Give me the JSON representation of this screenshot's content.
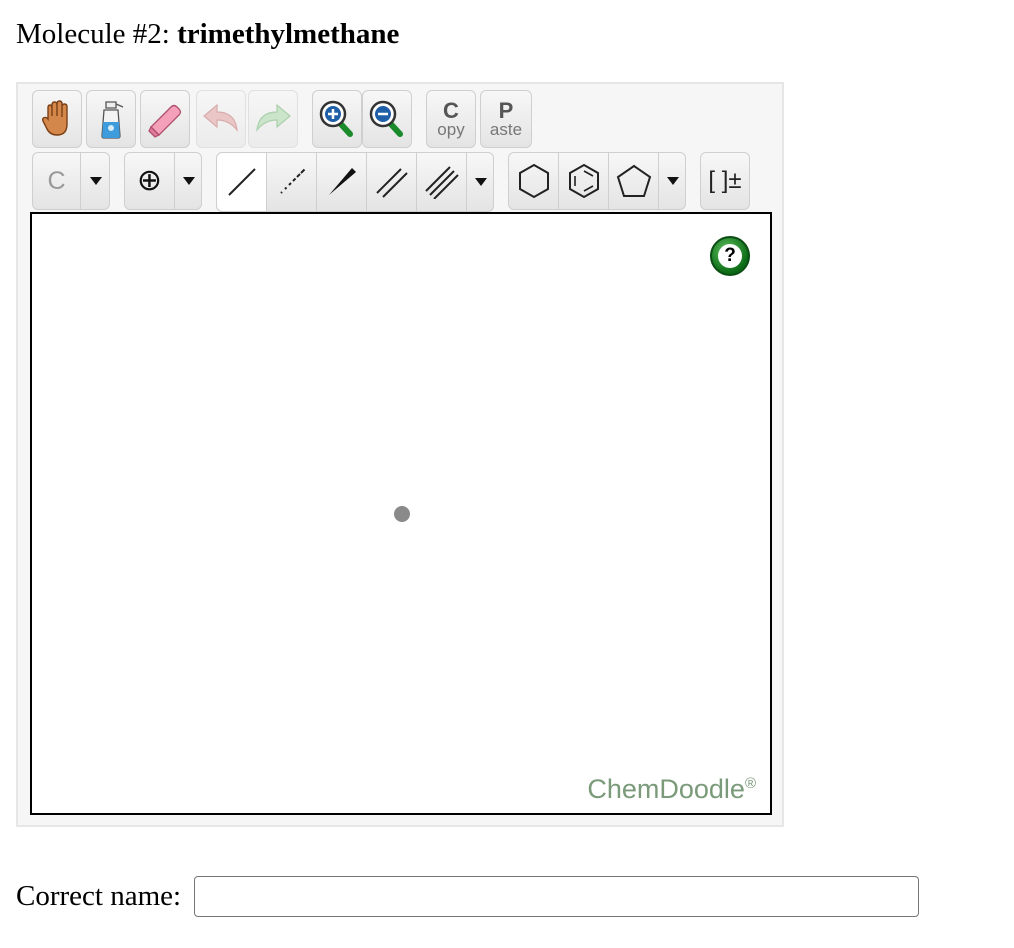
{
  "heading": {
    "prefix": "Molecule #2: ",
    "molecule": "trimethylmethane"
  },
  "toolbar": {
    "row1": [
      {
        "name": "pan-button",
        "icon": "hand-icon"
      },
      {
        "name": "clear-button",
        "icon": "spray-bottle-icon"
      },
      {
        "name": "erase-button",
        "icon": "eraser-icon"
      },
      {
        "name": "undo-button",
        "icon": "undo-icon"
      },
      {
        "name": "redo-button",
        "icon": "redo-icon"
      },
      {
        "name": "zoom-in-button",
        "icon": "zoom-in-icon"
      },
      {
        "name": "zoom-out-button",
        "icon": "zoom-out-icon"
      },
      {
        "name": "copy-button",
        "letter": "C",
        "rest": "opy"
      },
      {
        "name": "paste-button",
        "letter": "P",
        "rest": "aste"
      }
    ],
    "atom_label": "C",
    "charge_symbol": "⊕",
    "bracket_label": "[ ]±",
    "selected_bond": "single-bond"
  },
  "canvas": {
    "help_label": "?",
    "brand": "ChemDoodle",
    "brand_mark": "®"
  },
  "answer": {
    "label": "Correct name:",
    "value": "",
    "placeholder": ""
  },
  "colors": {
    "accent_green": "#0b6b15",
    "brand_text": "#7a9a7a",
    "atom_dot": "#8a8a8a"
  }
}
